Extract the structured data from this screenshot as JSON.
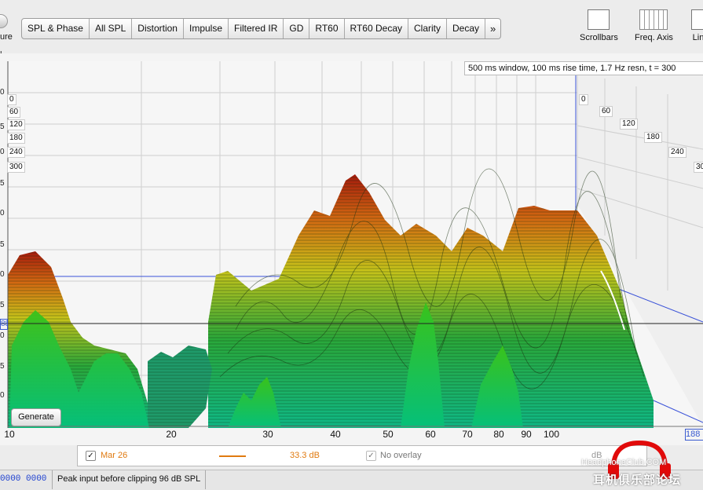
{
  "toolbar": {
    "left_partial_label": "ure",
    "tabs": [
      "SPL & Phase",
      "All SPL",
      "Distortion",
      "Impulse",
      "Filtered IR",
      "GD",
      "RT60",
      "RT60 Decay",
      "Clarity",
      "Decay"
    ],
    "more": "»",
    "scrollbars_label": "Scrollbars",
    "freq_axis_label": "Freq. Axis",
    "lin_partial_label": "Lin"
  },
  "graph": {
    "info_text": "500 ms window, 100 ms rise time,  1.7 Hz resn, t = 300",
    "y_unit_partial": "L",
    "y_ticks_partial": [
      "0",
      "5",
      "0",
      "5",
      "0",
      "5",
      "0",
      "5",
      "0",
      "5",
      "0",
      "5"
    ],
    "y_cursor_partial": "88",
    "time_labels_left": [
      "0",
      "60",
      "120",
      "180",
      "240",
      "300"
    ],
    "time_labels_right": [
      "0",
      "60",
      "120",
      "180",
      "240",
      "30"
    ],
    "x_ticks": [
      "10",
      "20",
      "30",
      "40",
      "50",
      "60",
      "70",
      "80",
      "90",
      "100"
    ],
    "x_cursor": "188",
    "generate_label": "Generate"
  },
  "legend": {
    "measurement_name": "Mar 26",
    "measurement_checked": true,
    "measurement_color": "#e07a10",
    "measurement_value": "33.3 dB",
    "overlay_label": "No overlay",
    "overlay_checked": true,
    "unit_partial": "dB"
  },
  "status": {
    "counter": "0000 0000",
    "message": "Peak input before clipping 96 dB SPL"
  },
  "watermark": {
    "site": "HeadphoneClub.COM",
    "cn": "耳机俱乐部论坛"
  }
}
